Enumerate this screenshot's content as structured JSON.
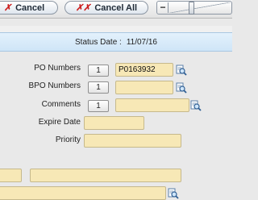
{
  "toolbar": {
    "cancel_label": "Cancel",
    "cancel_all_label": "Cancel All",
    "zoom_minus": "−"
  },
  "status": {
    "label": "Status Date :",
    "value": "11/07/16"
  },
  "form": {
    "po_label": "PO Numbers",
    "po_count": "1",
    "po_value": "P0163932",
    "bpo_label": "BPO Numbers",
    "bpo_count": "1",
    "bpo_value": "",
    "comments_label": "Comments",
    "comments_count": "1",
    "comments_value": "",
    "expire_label": "Expire Date",
    "expire_value": "",
    "priority_label": "Priority",
    "priority_value": ""
  },
  "colors": {
    "field_bg": "#f7e8b6",
    "status_bar": "#d6eaf9",
    "cancel_x": "#cc1f1f"
  }
}
